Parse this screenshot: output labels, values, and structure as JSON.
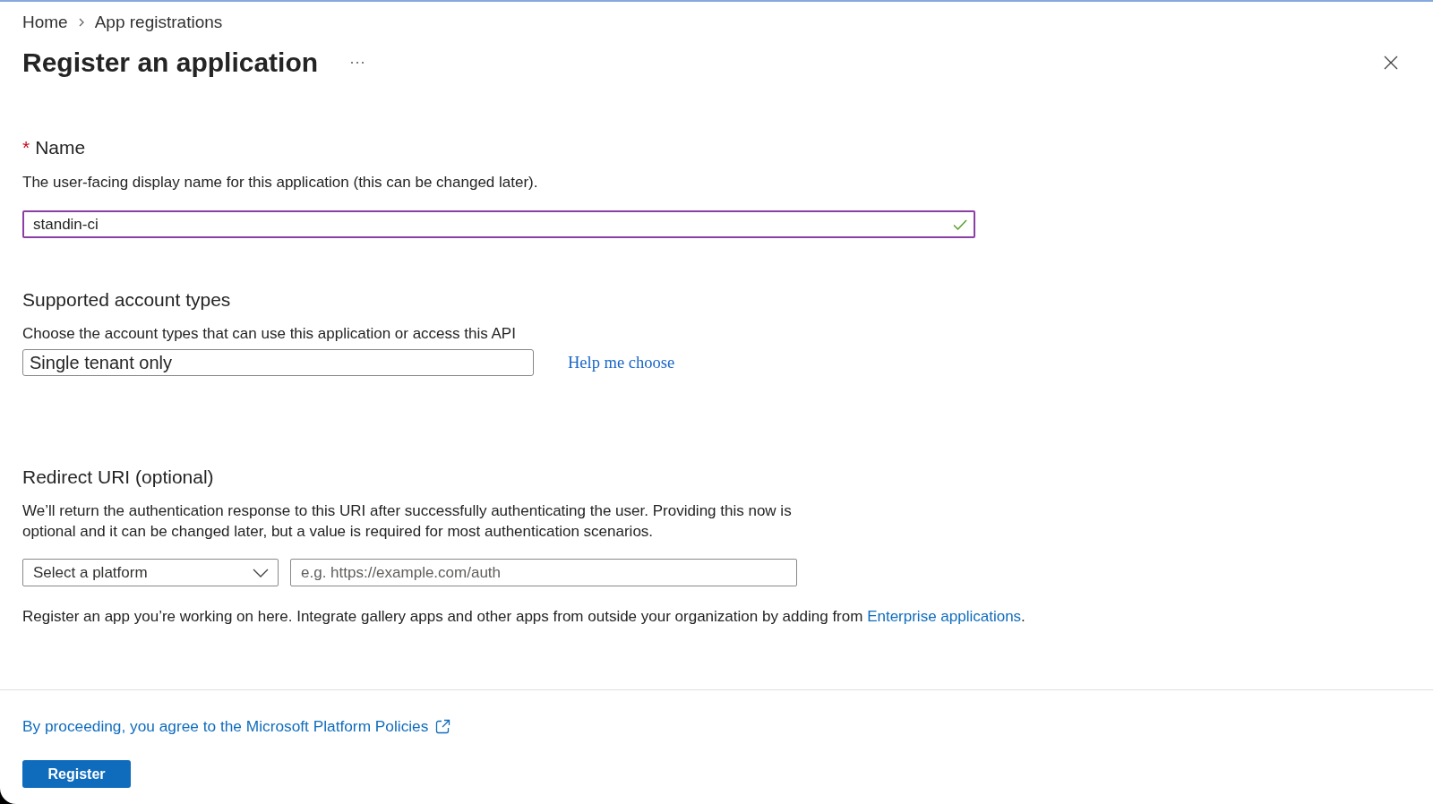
{
  "breadcrumb": [
    {
      "label": "Home"
    },
    {
      "label": "App registrations"
    }
  ],
  "header": {
    "title": "Register an application"
  },
  "name_section": {
    "required_marker": "*",
    "label": "Name",
    "description": "The user-facing display name for this application (this can be changed later).",
    "field": {
      "value": "standin-ci",
      "focused": true,
      "valid": true
    }
  },
  "account_types": {
    "title": "Supported account types",
    "description": "Choose the account types that can use this application or access this API",
    "selection": {
      "value": "Single tenant only"
    },
    "help_link": "Help me choose"
  },
  "redirect_uri": {
    "title": "Redirect URI (optional)",
    "description": "We’ll return the authentication response to this URI after successfully authenticating the user. Providing this now is optional and it can be changed later, but a value is required for most authentication scenarios.",
    "platform": {
      "placeholder": "Select a platform"
    },
    "uri": {
      "placeholder": "e.g. https://example.com/auth"
    }
  },
  "note": {
    "text": "Register an app you’re working on here. Integrate gallery apps and other apps from outside your organization by adding from ",
    "link": "Enterprise applications",
    "text_after": "."
  },
  "footer": {
    "policy_link": "By proceeding, you agree to the Microsoft Platform Policies",
    "register_button": "Register"
  }
}
